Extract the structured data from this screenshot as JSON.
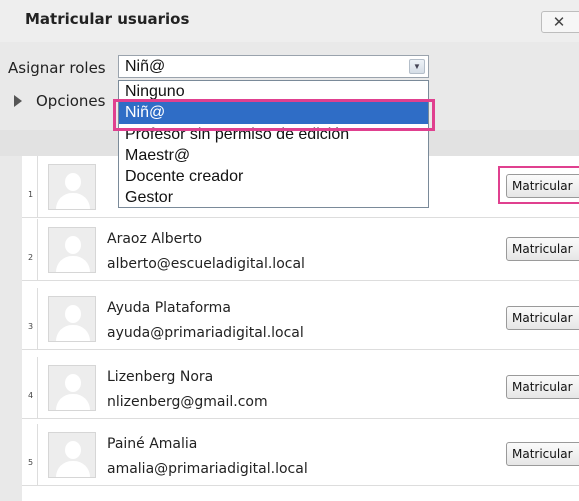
{
  "dialog": {
    "title": "Matricular usuarios",
    "close_label": "✕"
  },
  "roles": {
    "label": "Asignar roles",
    "selected": "Niñ@",
    "options": [
      "Ninguno",
      "Niñ@",
      "Profesor sin permiso de edición",
      "Maestr@",
      "Docente creador",
      "Gestor"
    ],
    "selected_index": 1
  },
  "options_toggle": {
    "label": "Opciones"
  },
  "users": [
    {
      "num": "1",
      "name": "",
      "email": "",
      "button": "Matricular"
    },
    {
      "num": "2",
      "name": "Araoz Alberto",
      "email": "alberto@escueladigital.local",
      "button": "Matricular"
    },
    {
      "num": "3",
      "name": "Ayuda Plataforma",
      "email": "ayuda@primariadigital.local",
      "button": "Matricular"
    },
    {
      "num": "4",
      "name": "Lizenberg Nora",
      "email": "nlizenberg@gmail.com",
      "button": "Matricular"
    },
    {
      "num": "5",
      "name": "Painé Amalia",
      "email": "amalia@primariadigital.local",
      "button": "Matricular"
    }
  ],
  "colors": {
    "highlight": "#e0408f",
    "selected_option": "#2f6dc6"
  }
}
